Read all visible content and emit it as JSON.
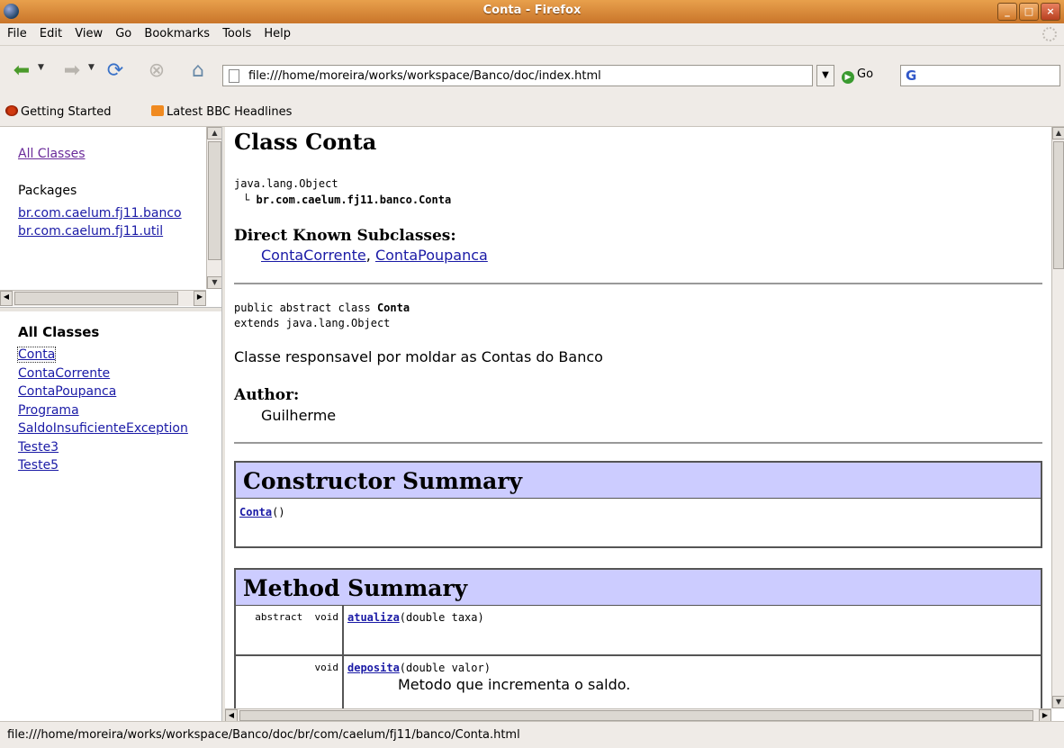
{
  "window": {
    "title": "Conta - Firefox",
    "buttons": [
      "_",
      "□",
      "×"
    ]
  },
  "menu": [
    "File",
    "Edit",
    "View",
    "Go",
    "Bookmarks",
    "Tools",
    "Help"
  ],
  "nav": {
    "url": "file:///home/moreira/works/workspace/Banco/doc/index.html",
    "go_label": "Go",
    "search_engine_letter": "G",
    "search_value": ""
  },
  "bookmarks": [
    "Getting Started",
    "Latest BBC Headlines"
  ],
  "packages_frame": {
    "all_classes_link": "All Classes",
    "packages_label": "Packages",
    "packages": [
      "br.com.caelum.fj11.banco",
      "br.com.caelum.fj11.util"
    ]
  },
  "classes_frame": {
    "heading": "All Classes",
    "classes": [
      "Conta",
      "ContaCorrente",
      "ContaPoupanca",
      "Programa",
      "SaldoInsuficienteException",
      "Teste3",
      "Teste5"
    ]
  },
  "main": {
    "class_title": "Class Conta",
    "hierarchy_root": "java.lang.Object",
    "hierarchy_child": "br.com.caelum.fj11.banco.Conta",
    "subclasses_heading": "Direct Known Subclasses:",
    "subclasses": [
      "ContaCorrente",
      "ContaPoupanca"
    ],
    "subclasses_sep": ", ",
    "decl_prefix": "public abstract class ",
    "decl_name": "Conta",
    "decl_extends": "extends java.lang.Object",
    "description": "Classe responsavel por moldar as Contas do Banco",
    "author_label": "Author:",
    "author": "Guilherme",
    "constructor_summary": {
      "title": "Constructor Summary",
      "name": "Conta",
      "params": "()"
    },
    "method_summary": {
      "title": "Method Summary",
      "rows": [
        {
          "modifier": "abstract  void",
          "name": "atualiza",
          "params": "(double taxa)",
          "desc": ""
        },
        {
          "modifier": "void",
          "name": "deposita",
          "params": "(double valor)",
          "desc": "Metodo que incrementa o saldo."
        }
      ]
    }
  },
  "status": "file:///home/moreira/works/workspace/Banco/doc/br/com/caelum/fj11/banco/Conta.html"
}
